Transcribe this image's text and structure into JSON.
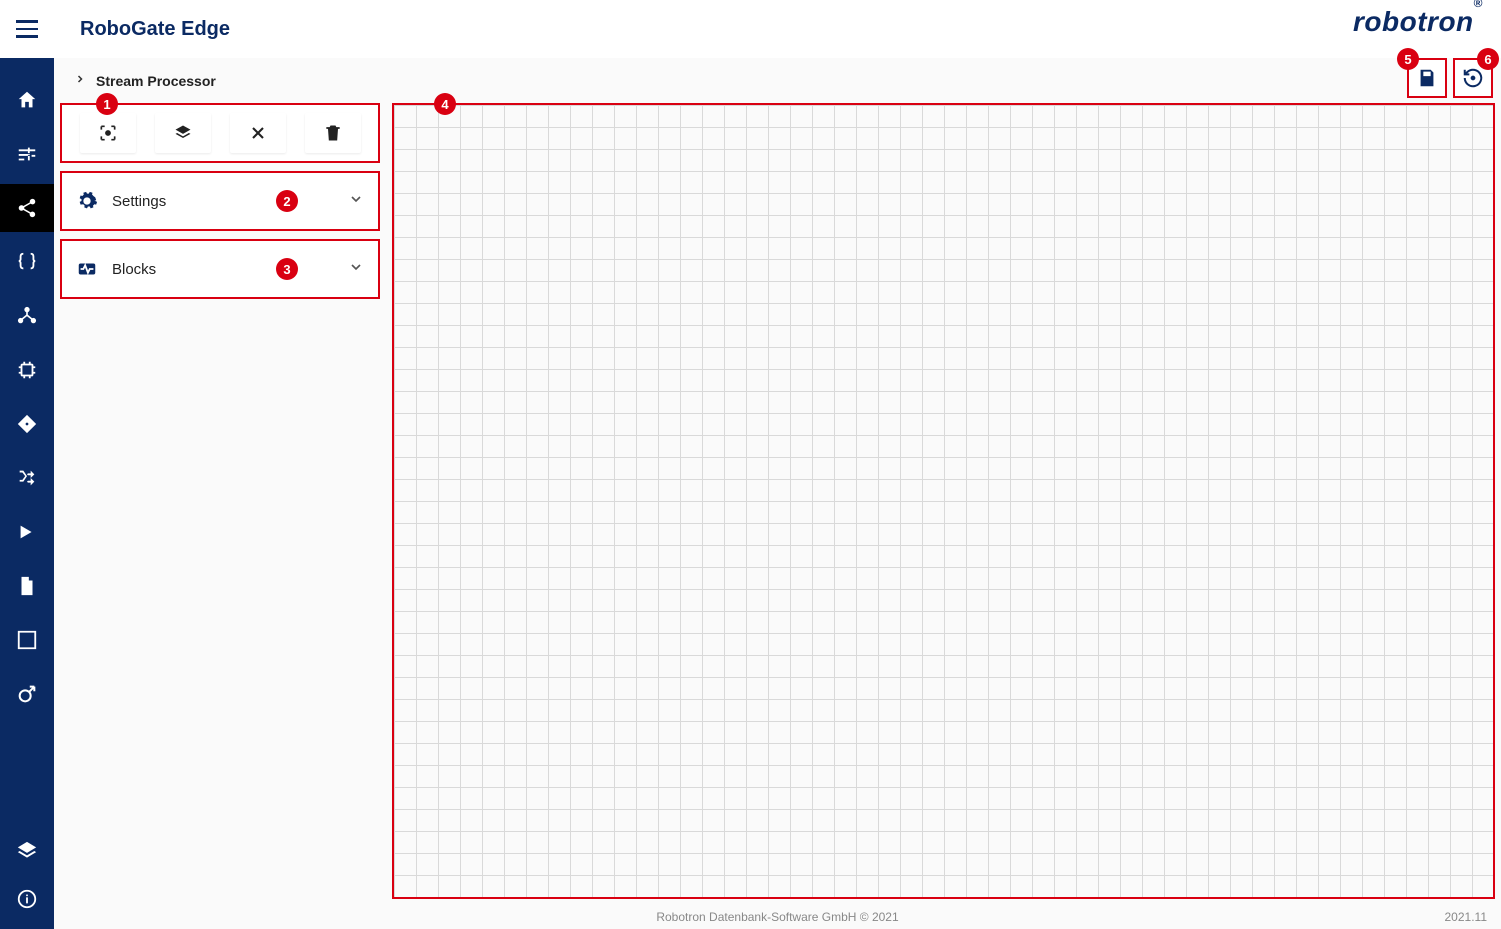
{
  "header": {
    "app_title": "RoboGate Edge",
    "brand": "robotron"
  },
  "breadcrumb": {
    "label": "Stream Processor"
  },
  "panels": {
    "settings_label": "Settings",
    "blocks_label": "Blocks"
  },
  "footer": {
    "copyright": "Robotron Datenbank-Software GmbH © 2021",
    "version": "2021.11"
  },
  "annotations": {
    "a1": "1",
    "a2": "2",
    "a3": "3",
    "a4": "4",
    "a5": "5",
    "a6": "6"
  }
}
